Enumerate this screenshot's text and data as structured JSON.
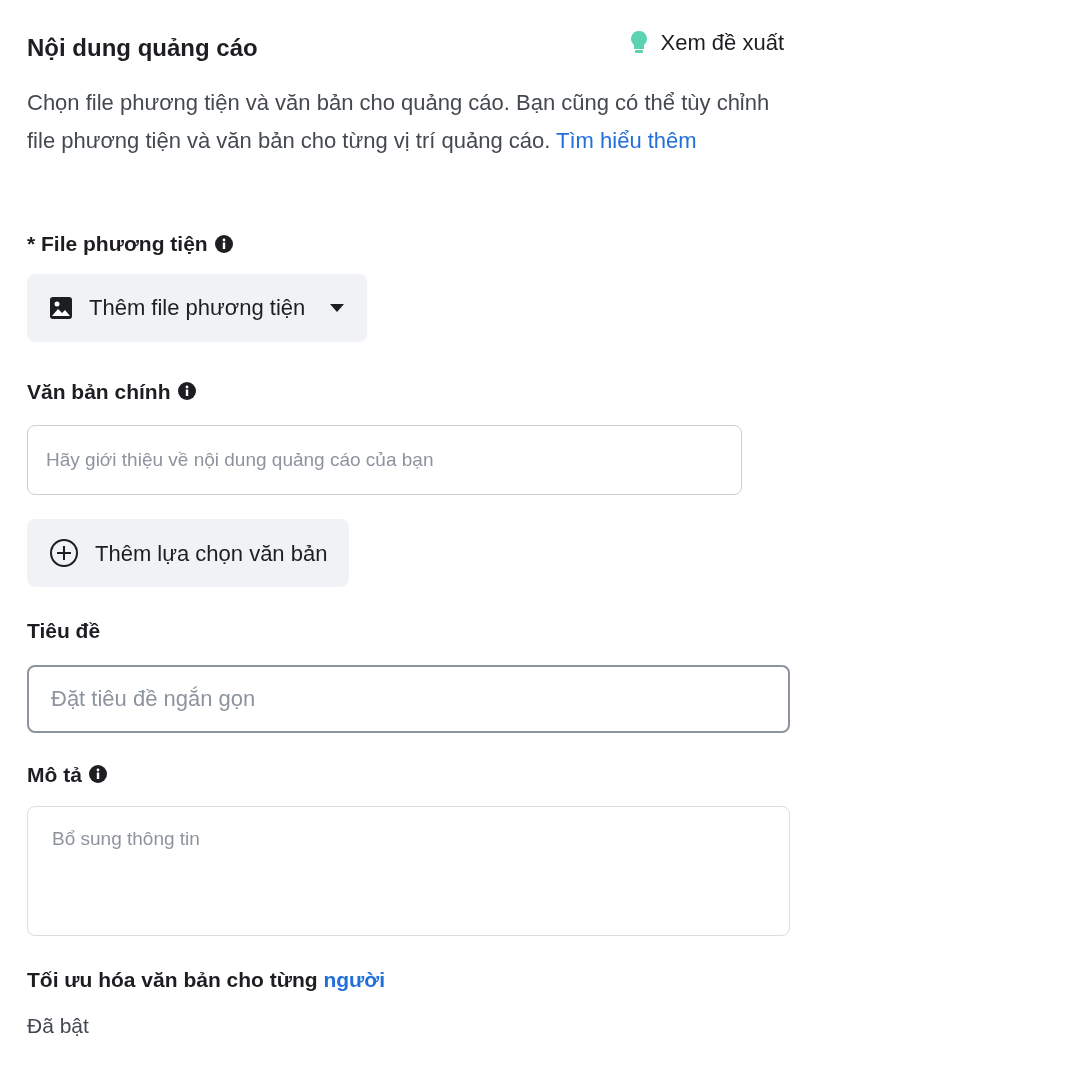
{
  "header": {
    "title": "Nội dung quảng cáo",
    "suggestion": "Xem đề xuất"
  },
  "intro": {
    "text": "Chọn file phương tiện và văn bản cho quảng cáo. Bạn cũng có thể tùy chỉnh file phương tiện và văn bản cho từng vị trí quảng cáo.",
    "link": "Tìm hiểu thêm"
  },
  "media": {
    "required_mark": "*",
    "label": "File phương tiện",
    "button": "Thêm file phương tiện"
  },
  "primary_text": {
    "label": "Văn bản chính",
    "placeholder": "Hãy giới thiệu về nội dung quảng cáo của bạn",
    "add_button": "Thêm lựa chọn văn bản"
  },
  "headline": {
    "label": "Tiêu đề",
    "placeholder": "Đặt tiêu đề ngắn gọn"
  },
  "description": {
    "label": "Mô tả",
    "placeholder": "Bổ sung thông tin"
  },
  "optimization": {
    "label": "Tối ưu hóa văn bản cho từng",
    "link": "người",
    "status": "Đã bật"
  }
}
